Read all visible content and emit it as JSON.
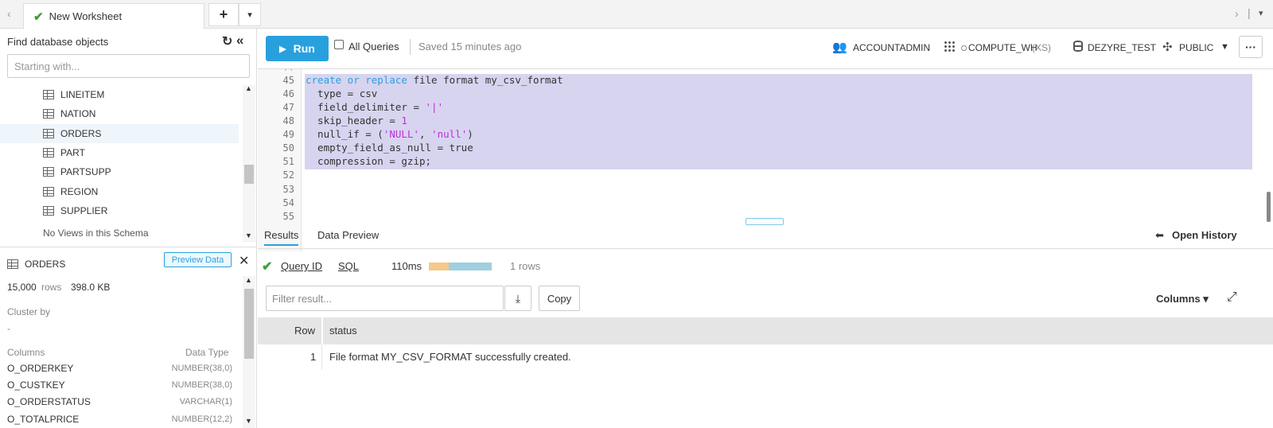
{
  "tabs": {
    "worksheet_title": "New Worksheet",
    "add_label": "+",
    "menu_label": "▾"
  },
  "sidebar": {
    "find_label": "Find database objects",
    "search_placeholder": "Starting with...",
    "tables": [
      "LINEITEM",
      "NATION",
      "ORDERS",
      "PART",
      "PARTSUPP",
      "REGION",
      "SUPPLIER"
    ],
    "selected_table": "ORDERS",
    "no_views": "No Views in this Schema"
  },
  "details": {
    "table_name": "ORDERS",
    "preview_label": "Preview Data",
    "rows_count": "15,000",
    "rows_label": "rows",
    "size": "398.0 KB",
    "cluster_label": "Cluster by",
    "cluster_value": "-",
    "columns_header": "Columns",
    "datatype_header": "Data Type",
    "columns": [
      {
        "name": "O_ORDERKEY",
        "type": "NUMBER(38,0)"
      },
      {
        "name": "O_CUSTKEY",
        "type": "NUMBER(38,0)"
      },
      {
        "name": "O_ORDERSTATUS",
        "type": "VARCHAR(1)"
      },
      {
        "name": "O_TOTALPRICE",
        "type": "NUMBER(12,2)"
      }
    ]
  },
  "toolbar": {
    "run_label": "Run",
    "all_queries_label": "All Queries",
    "saved_text": "Saved 15 minutes ago",
    "role": "ACCOUNTADMIN",
    "warehouse": "COMPUTE_WH",
    "warehouse_size": "(XS)",
    "database": "DEZYRE_TEST",
    "schema": "PUBLIC",
    "more_label": "···"
  },
  "editor": {
    "line_numbers": [
      "45",
      "46",
      "47",
      "48",
      "49",
      "50",
      "51",
      "52",
      "53",
      "54",
      "55"
    ],
    "code": {
      "l45_kw": "create or replace",
      "l45_rest": " file format my_csv_format",
      "l46": "  type = csv",
      "l47_a": "  field_delimiter = ",
      "l47_str": "'|'",
      "l48_a": "  skip_header = ",
      "l48_num": "1",
      "l49_a": "  null_if = (",
      "l49_s1": "'NULL'",
      "l49_b": ", ",
      "l49_s2": "'null'",
      "l49_c": ")",
      "l50": "  empty_field_as_null = true",
      "l51": "  compression = gzip;"
    }
  },
  "results": {
    "tab_results": "Results",
    "tab_preview": "Data Preview",
    "open_history": "Open History",
    "query_id_label": "Query ID",
    "sql_label": "SQL",
    "duration": "110ms",
    "rows_returned": "1 rows",
    "filter_placeholder": "Filter result...",
    "copy_label": "Copy",
    "columns_label": "Columns ▾",
    "grid": {
      "headers": [
        "Row",
        "status"
      ],
      "rows": [
        [
          "1",
          "File format MY_CSV_FORMAT successfully created."
        ]
      ]
    }
  },
  "colors": {
    "accent": "#29a0de",
    "success": "#3aa13a",
    "selection": "#d7d4f0"
  }
}
